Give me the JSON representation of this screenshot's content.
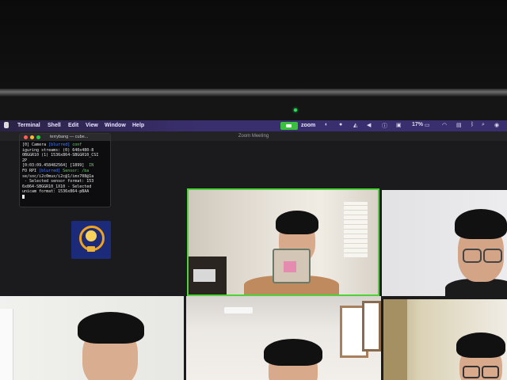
{
  "menubar": {
    "items": [
      "Terminal",
      "Shell",
      "Edit",
      "View",
      "Window",
      "Help"
    ],
    "app_name": "zoom",
    "battery": "17%"
  },
  "zoom_window": {
    "title": "Zoom Meeting"
  },
  "terminal": {
    "title": "terrybang — cube...",
    "lines": [
      [
        "[0] Camera ",
        "[blurred]",
        " conf"
      ],
      [
        "iguring streams: (0) 640x480-8"
      ],
      [
        "0BGGR10 (1) 1536x864-SBGGR10_CSI"
      ],
      [
        "2P"
      ],
      [
        "[0:03:09.458482564] [1899]  ",
        "",
        "IN"
      ],
      [
        "FO RPI ",
        "[blurred]",
        " Sensor: /ba"
      ],
      [
        "se/soc/i2c0mux/i2c@1/imx708@1a"
      ],
      [
        " - Selected sensor format: 153"
      ],
      [
        "6x864-SBGGR10_1X10 - Selected"
      ],
      [
        "unicam format: 1536x864-pBAA"
      ]
    ]
  },
  "colors": {
    "menubar": "#3a2f6e",
    "active_speaker_border": "#4dd23a",
    "zoom_green": "#3bbf3f"
  },
  "icons": [
    "apple-icon",
    "zoom-video-icon",
    "wifi-icon",
    "battery-icon",
    "volume-icon",
    "bluetooth-icon",
    "search-icon",
    "control-center-icon"
  ]
}
